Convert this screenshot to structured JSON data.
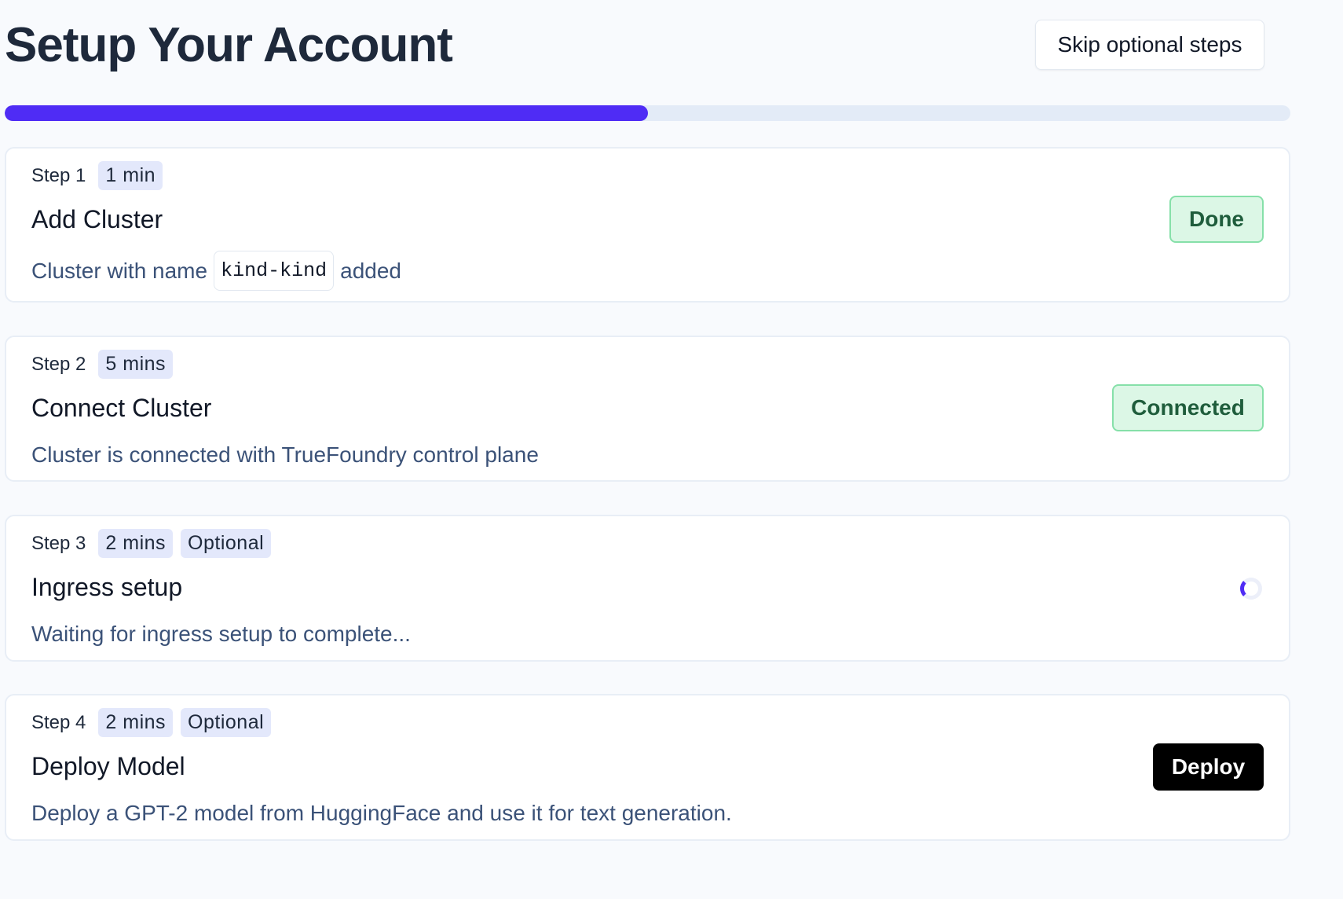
{
  "header": {
    "title": "Setup Your Account",
    "skip_label": "Skip optional steps"
  },
  "progress": {
    "fraction": 0.5
  },
  "steps": [
    {
      "label": "Step 1",
      "badges": [
        "1 min"
      ],
      "title": "Add Cluster",
      "desc_prefix": "Cluster with name",
      "code": "kind-kind",
      "desc_suffix": "added",
      "status": "Done"
    },
    {
      "label": "Step 2",
      "badges": [
        "5 mins"
      ],
      "title": "Connect Cluster",
      "desc": "Cluster is connected with TrueFoundry control plane",
      "status": "Connected"
    },
    {
      "label": "Step 3",
      "badges": [
        "2 mins",
        "Optional"
      ],
      "title": "Ingress setup",
      "desc": "Waiting for ingress setup to complete...",
      "status_icon": "loading-spinner-icon"
    },
    {
      "label": "Step 4",
      "badges": [
        "2 mins",
        "Optional"
      ],
      "title": "Deploy Model",
      "desc": "Deploy a GPT-2 model from HuggingFace and use it for text generation.",
      "action": "Deploy"
    }
  ],
  "colors": {
    "accent": "#4f2cf5",
    "success_bg": "#dcf7e6",
    "success_text": "#1f5d3c",
    "desc_text": "#3b5278"
  }
}
